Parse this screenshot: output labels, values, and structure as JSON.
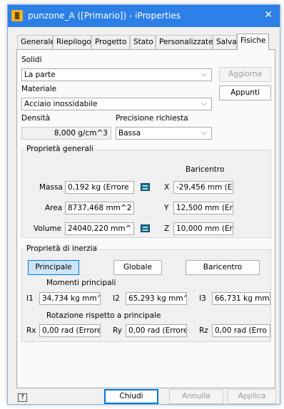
{
  "window": {
    "title": "punzone_A ([Primario]) - iProperties"
  },
  "tabs": [
    {
      "label": "Generale"
    },
    {
      "label": "Riepilogo"
    },
    {
      "label": "Progetto"
    },
    {
      "label": "Stato"
    },
    {
      "label": "Personalizzate"
    },
    {
      "label": "Salva"
    },
    {
      "label": "Fisiche"
    }
  ],
  "physical": {
    "solids_label": "Solidi",
    "solids_value": "La parte",
    "update_button": "Aggiorna",
    "material_label": "Materiale",
    "material_value": "Acciaio inossidabile",
    "clipboard_button": "Appunti",
    "density_label": "Densità",
    "density_value": "8,000 g/cm^3",
    "precision_label": "Precisione richiesta",
    "precision_value": "Bassa",
    "general": {
      "title": "Proprietà generali",
      "centroid_header": "Baricentro",
      "mass_label": "Massa",
      "mass_value": "0,192 kg (Errore",
      "area_label": "Area",
      "area_value": "8737,468 mm^2",
      "volume_label": "Volume",
      "volume_value": "24040,220 mm^",
      "x_label": "X",
      "x_value": "-29,456 mm (Err",
      "y_label": "Y",
      "y_value": "12,500 mm (Errc",
      "z_label": "Z",
      "z_value": "10,000 mm (Errc"
    },
    "inertia": {
      "title": "Proprietà di inerzia",
      "principal_button": "Principale",
      "global_button": "Globale",
      "centroid_button": "Baricentro",
      "principal_moments_label": "Momenti principali",
      "i1_label": "I1",
      "i1_value": "34,734 kg mm^",
      "i2_label": "I2",
      "i2_value": "65,293 kg mm^",
      "i3_label": "I3",
      "i3_value": "66,731 kg mm",
      "rotation_label": "Rotazione rispetto a principale",
      "rx_label": "Rx",
      "rx_value": "0,00 rad (Errore",
      "ry_label": "Ry",
      "ry_value": "0,00 rad (Errore",
      "rz_label": "Rz",
      "rz_value": "0,00 rad (Erro"
    }
  },
  "footer": {
    "help_glyph": "?",
    "close_button": "Chiudi",
    "cancel_button": "Annulla",
    "apply_button": "Applica"
  },
  "colors": {
    "titlebar": "#2b7fe6",
    "accent": "#0078d7",
    "app_icon": "#f2b21b"
  },
  "icons": [
    "app-icon",
    "close-icon",
    "calculator-icon",
    "help-icon",
    "chevron-down-icon"
  ]
}
